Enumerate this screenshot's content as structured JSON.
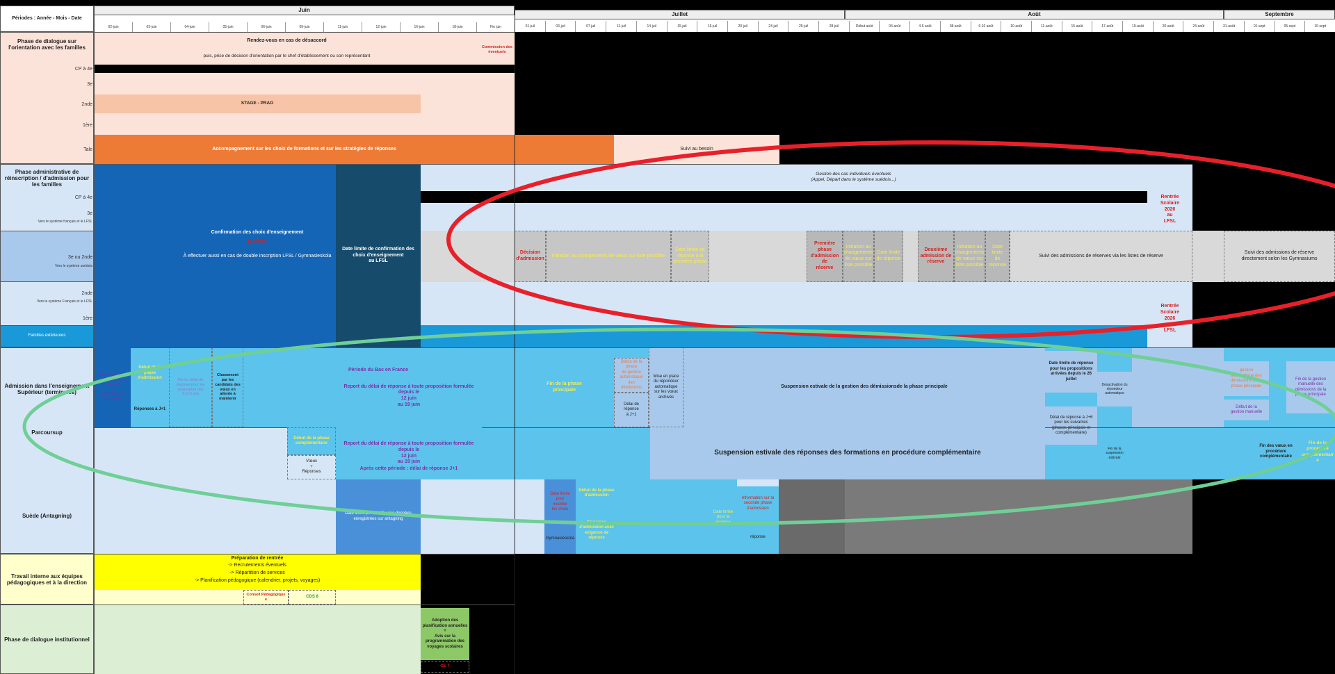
{
  "header": {
    "periods_label": "Périodes : Année - Mois - Date",
    "months": [
      "Juin",
      "Juillet",
      "Août",
      "Septembre"
    ],
    "days_june": [
      "02-juin",
      "03-juin",
      "04-juin",
      "05-juin",
      "06-juin",
      "09-juin",
      "11-juin",
      "12-juin",
      "16-juin",
      "18-juin",
      "Fin juin"
    ],
    "days_after": [
      "01-juil",
      "03-juil",
      "07-juil",
      "11-juil",
      "14-juil",
      "15-juil",
      "16-juil",
      "20-juil",
      "24-juil",
      "25-juil",
      "28-juil",
      "Début août",
      "04-août",
      "4-6 août",
      "08-août",
      "6-10 août",
      "10-août",
      "11-août",
      "15-août",
      "17-août",
      "19-août",
      "20-août",
      "24-août",
      "31-août",
      "01-sept",
      "05-sept",
      "10-sept"
    ]
  },
  "sections": {
    "dialogue": {
      "label": "Phase de dialogue sur l'orientation avec les familles",
      "rows": [
        "CP à 4e",
        "3e",
        "2nde",
        "1ère",
        "Tale"
      ],
      "rdv": "Rendez-vous en cas de désaccord",
      "decision": "puis, prise de décision d'orientation par le chef d'établissement ou son représentant",
      "commission": "Commission des\n éventuels",
      "stage": "STAGE - PRAO",
      "accompagnement": "Accompagnement sur les choix de formations et sur les stratégies de réponses",
      "suivi": "Suivi au besoin"
    },
    "admin": {
      "label": "Phase administrative de réinscription / d'admission pour les familles",
      "rows": [
        "CP à 4e",
        "3e",
        "3e ou 2nde",
        "2nde",
        "1ère",
        "Familles extérieures"
      ],
      "notes": [
        "Vers le système français et le LFSL",
        "Vers le système suédois",
        "Vers le système Français et le LFSL"
      ],
      "gestion": "Gestion des cas individuels éventuels\n(Appel, Départ dans le système suédois...)",
      "confirmation": "Confirmation des choix d'enseignement",
      "confirmation_date": "(12 juin)",
      "double": "À effectuer aussi en cas de double inscription LFSL / Gymnasieskola",
      "date_limite": "Date limite de confirmation des choix d'enseignement\nau LFSL",
      "rentree": "Rentrée\nScolaire\n2026\nau\nLFSL",
      "decision_admission": "Décision\nd'admission",
      "initiation_1": "Initiation au changements de vœux sur liste possible",
      "date_limite_reponse_1": "Date limite de réponse à la première phase",
      "premiere_phase": "Première phase\nd'admission de\nréserve",
      "initiation_2": "Initiation au\nchangements\nde vœux sur\nliste possible",
      "date_limite_2": "Date limite\nde réponse",
      "deuxieme": "Deuxième\nadmission de\nréserve",
      "initiation_3": "Initiation au\nchangements\nde vœux sur\nliste possible",
      "date_limite_3": "Date limite\nde\nréponse",
      "suivi_reserve": "Suivi des admissions de réserves via les listes de réserve",
      "suivi_gymn": "Suivi des admissions de réserve\ndirectement selon les Gymnasiums"
    },
    "superieur": {
      "label": "Admission dans l'enseignement Supérieur (terminales)",
      "parcoursup": "Parcoursup",
      "suede": "Suède (Antagning)",
      "consultation": "Consultation de la fiche Avenir des\nretenues\n+\n1ère réponse\nadmission",
      "debut_phase": "Début de la phase\nd'admission",
      "reponses_j1": "Réponses à J+1",
      "fin_delai": "Fin du délai de\nréponse pour les\nproposition des\n2 et 3 juin",
      "classement": "Classement\npar les\ncandidats des\nvœux en\nattente à\nmaintenir",
      "bac": "Période du Bac en France",
      "report_1": "Report du délai de réponse à toute proposition formulée depuis le\n12 juin\nau 19 juin",
      "fin_principale": "Fin de la phase\nprincipale",
      "debut_gestion": "Début de la phase\nde gestion\nautomatique des\ndémissions",
      "mise_en_place": "Mise en place\ndu répondeur\nautomatique\nsur les vœux\narchivés",
      "delai_j1": "Délai de réponse\nà J+1",
      "suspension_demissions": "Suspension estivale de la gestion des démissionsde la phase principale",
      "date_limite_26": "Date limite de réponse\npour les propositions\narrivées depuis le 26\njuillet",
      "delai_j6": "Délai de réponse à J+6\npour les suivantes\n(phases principale et\ncomplémentaire)",
      "desactivation": "Désactivation du\nrépondeur\nautomatique",
      "gestion_auto": "gestion\nautomatique des\ndémissions de la\nphase principale",
      "debut_manuelle": "Début de la\ngestion manuelle",
      "manuelle": "Fin de la gestion\nmanuelle des\ndémissions de la\nphase principale",
      "debut_complementaire": "Début de la phase\ncomplémentaire",
      "voeux_reponses": "Vœux\n+\nRéponses",
      "report_2": "Report du délai de réponse à toute proposition formulée depuis le\n12 juin\nau 19 juin",
      "apres": "Après cette période : délai de réponse J+1",
      "suspension_reponses": "Suspension estivale des réponses des formations en procédure complémentaire",
      "fin_suspension": "Fin de la\nsuspension\nestivale",
      "fin_voeux": "Fin des vœux en\nprocédure\ncomplémentaire",
      "fin_procedure": "Fin de la\nprocédure\ncomplémentair\ne",
      "verifier": "Date limite pour vérifier les données\nenregistrées sur antagning",
      "date_limite_echange": "Date limite\npour\nmodifier\nles choix",
      "gymnasieskola": "Gymnasieskola",
      "debut_admission_suede": "Début de la phase\nd'admission",
      "decisions": "Décisions\nd'admission avec\nexigence de\nréponse",
      "date_limite_reponse_suede": "Date limite\npour la\nréponse",
      "info_seconde": "Information sur la\nseconde phase\nd'admission",
      "reponse": "réponse"
    },
    "travail": {
      "label": "Travail interne aux équipes pédagogiques et à la direction",
      "prep_title": "Préparation de rentrée",
      "prep_lines": [
        "-> Recrutements éventuels",
        "-> Répartition de services",
        "-> Planification pédagogique (calendrier, projets, voyages)"
      ],
      "conseil": "Conseil Pédagogique\ne",
      "cds": "CDS 8"
    },
    "institutionnel": {
      "label": "Phase de dialogue institutionnel",
      "adoption": "Adoption des\nplanification annuelles\n+\nAvis sur la\nprogrammation des\nvoyages scolaires",
      "ce": "CE 7"
    }
  },
  "colors": {
    "peach": "#fce3d9",
    "orange": "#ed7b36",
    "light_blue": "#d6e6f6",
    "mid_blue": "#a8c9ec",
    "blue": "#1565b6",
    "dark_teal": "#164b6b",
    "sky": "#5bc3ec",
    "yellow_bg": "#ffffcc",
    "green_bg": "#dcefd4",
    "green": "#8dc866",
    "grey": "#cfcfcf",
    "dark_grey": "#7a7a7a",
    "red_ellipse": "#e8202a",
    "green_ellipse": "#6fcf97"
  }
}
